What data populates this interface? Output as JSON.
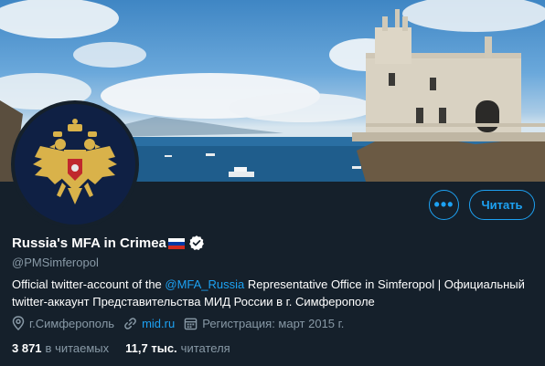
{
  "profile": {
    "display_name": "Russia's MFA in Crimea",
    "flag_colors": [
      "#ffffff",
      "#0039a6",
      "#d52b1e"
    ],
    "handle": "@PMSimferopol",
    "verified": true,
    "bio_prefix": "Official twitter-account of the ",
    "bio_mention": "@MFA_Russia",
    "bio_suffix": " Representative Office in Simferopol | Официальный twitter-аккаунт Представительства МИД России в г. Симферополе",
    "location": "г.Симферополь",
    "website": "mid.ru",
    "joined": "Регистрация: март 2015 г."
  },
  "actions": {
    "more_label": "•••",
    "follow_label": "Читать"
  },
  "stats": {
    "following_count": "3 871",
    "following_label": "в читаемых",
    "followers_count": "11,7 тыс.",
    "followers_label": "читателя"
  },
  "colors": {
    "background": "#15202b",
    "accent": "#1da1f2",
    "muted": "#8899a6",
    "avatar_bg": "#0f2044",
    "emblem_gold": "#d9b24a"
  },
  "icons": {
    "verified": "verified-badge-icon",
    "location": "location-pin-icon",
    "link": "link-icon",
    "calendar": "calendar-icon"
  }
}
